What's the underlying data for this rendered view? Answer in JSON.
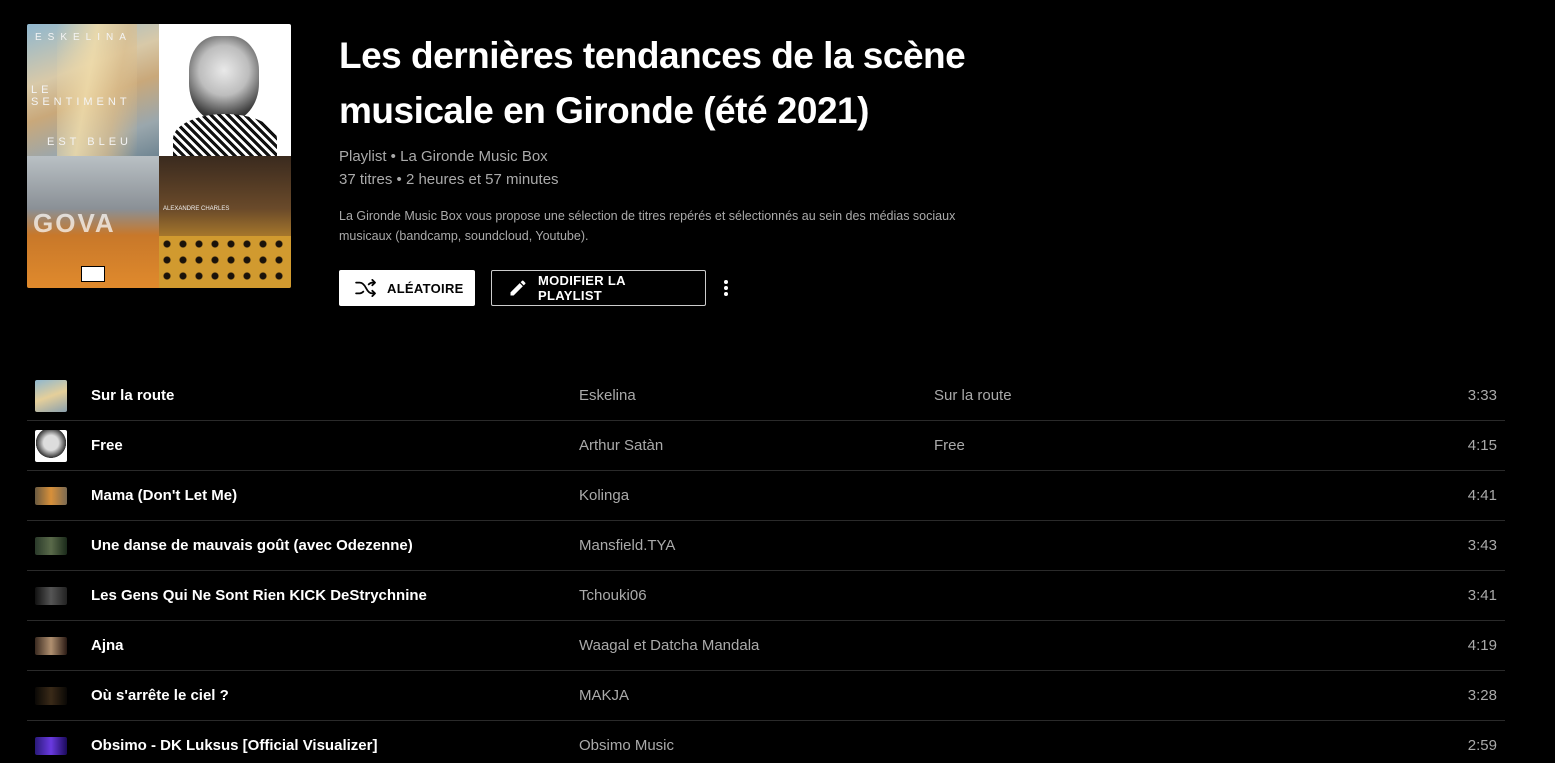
{
  "header": {
    "cover_texts": {
      "tile1_line1": "ESKELINA",
      "tile1_line2": "LE SENTIMENT",
      "tile1_line3": "EST BLEU",
      "tile3_text": "GOVA",
      "tile4_text": "ALEXANDRE CHARLES"
    },
    "title": "Les dernières tendances de la scène musicale en Gironde (été 2021)",
    "meta_line1": "Playlist • La Gironde Music Box",
    "meta_line2": "37 titres • 2 heures et 57 minutes",
    "description": "La Gironde Music Box vous propose une sélection de titres repérés et sélectionnés au sein des médias sociaux musicaux (bandcamp, soundcloud, Youtube).",
    "shuffle_label": "ALÉATOIRE",
    "edit_label": "MODIFIER LA PLAYLIST",
    "icons": {
      "shuffle": "shuffle-icon",
      "edit": "pencil-icon",
      "more": "more-vert-icon"
    }
  },
  "tracks": [
    {
      "title": "Sur la route",
      "artist": "Eskelina",
      "album": "Sur la route",
      "duration": "3:33"
    },
    {
      "title": "Free",
      "artist": "Arthur Satàn",
      "album": "Free",
      "duration": "4:15"
    },
    {
      "title": "Mama (Don't Let Me)",
      "artist": "Kolinga",
      "album": "",
      "duration": "4:41"
    },
    {
      "title": "Une danse de mauvais goût (avec Odezenne)",
      "artist": "Mansfield.TYA",
      "album": "",
      "duration": "3:43"
    },
    {
      "title": "Les Gens Qui Ne Sont Rien KICK DeStrychnine",
      "artist": "Tchouki06",
      "album": "",
      "duration": "3:41"
    },
    {
      "title": "Ajna",
      "artist": "Waagal et Datcha Mandala",
      "album": "",
      "duration": "4:19"
    },
    {
      "title": "Où s'arrête le ciel ?",
      "artist": "MAKJA",
      "album": "",
      "duration": "3:28"
    },
    {
      "title": "Obsimo - DK Luksus [Official Visualizer]",
      "artist": "Obsimo Music",
      "album": "",
      "duration": "2:59"
    }
  ],
  "colors": {
    "background": "#000000",
    "text_primary": "#ffffff",
    "text_secondary": "#aaaaaa",
    "divider": "#2a2a2a"
  }
}
